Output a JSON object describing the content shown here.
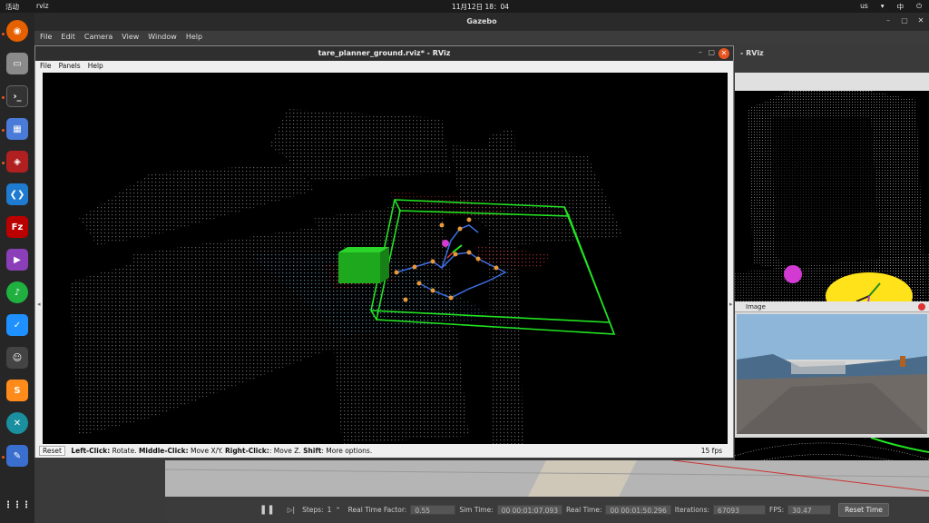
{
  "topbar": {
    "activities": "活动",
    "app": "rviz",
    "clock": "11月12日 18：04",
    "tray": [
      "us",
      "中"
    ]
  },
  "gazebo": {
    "title": "Gazebo",
    "menu": [
      "File",
      "Edit",
      "Camera",
      "View",
      "Window",
      "Help"
    ],
    "rviz_title_right": "- RViz",
    "image_panel": "Image",
    "bottom": {
      "steps_label": "Steps:",
      "steps_value": "1",
      "rtf_label": "Real Time Factor:",
      "rtf_value": "0.55",
      "sim_label": "Sim Time:",
      "sim_value": "00 00:01:07.093",
      "real_label": "Real Time:",
      "real_value": "00 00:01:50.296",
      "iter_label": "Iterations:",
      "iter_value": "67093",
      "fps_label": "FPS:",
      "fps_value": "30.47",
      "reset_time": "Reset Time"
    }
  },
  "rviz": {
    "title": "tare_planner_ground.rviz* - RViz",
    "menu": [
      "File",
      "Panels",
      "Help"
    ],
    "status": {
      "reset": "Reset",
      "lc": "Left-Click:",
      "lc_t": " Rotate. ",
      "mc": "Middle-Click:",
      "mc_t": " Move X/Y. ",
      "rc": "Right-Click:",
      "rc_t": ": Move Z. ",
      "sh": "Shift",
      "sh_t": ": More options.",
      "fps": "15 fps"
    }
  },
  "colors": {
    "accent": "#e95420",
    "frontier": "#21e421",
    "path": "#3b6fe0",
    "waypoint": "#e89a3a"
  }
}
